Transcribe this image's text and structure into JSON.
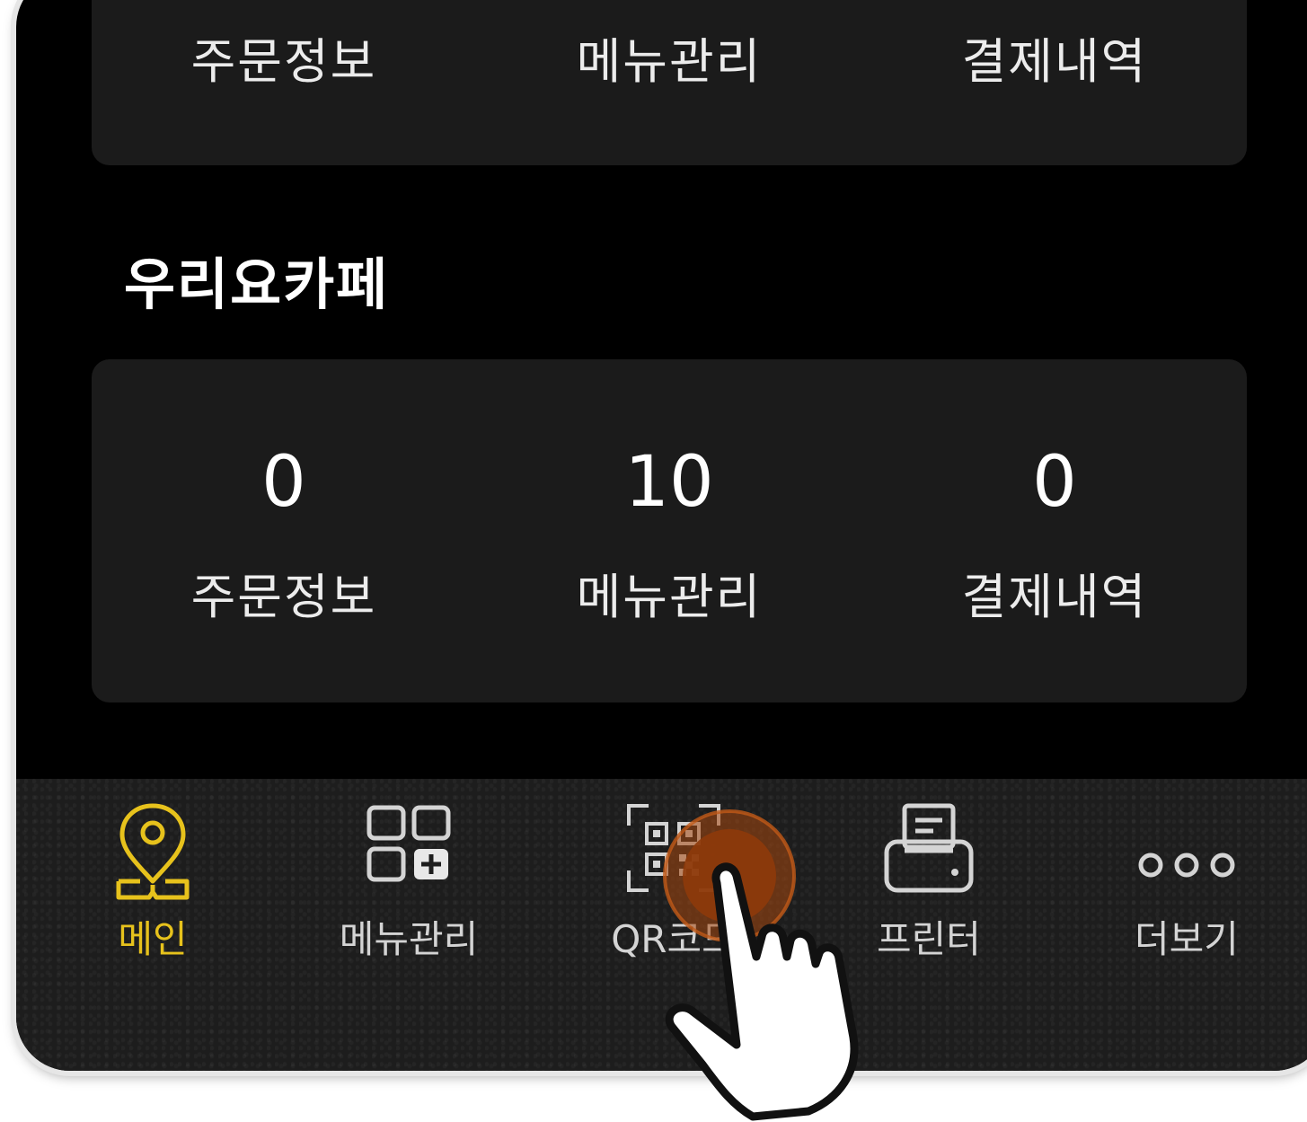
{
  "top_summary": {
    "items": [
      {
        "label": "주문정보"
      },
      {
        "label": "메뉴관리"
      },
      {
        "label": "결제내역"
      }
    ]
  },
  "store": {
    "name": "우리요카페",
    "stats": [
      {
        "value": "0",
        "label": "주문정보"
      },
      {
        "value": "10",
        "label": "메뉴관리"
      },
      {
        "value": "0",
        "label": "결제내역"
      }
    ]
  },
  "tabbar": {
    "active": "메인",
    "tabs": [
      {
        "label": "메인",
        "icon": "map-pin-book-icon"
      },
      {
        "label": "메뉴관리",
        "icon": "grid-add-icon"
      },
      {
        "label": "QR코드",
        "icon": "qr-code-icon"
      },
      {
        "label": "프린터",
        "icon": "printer-icon"
      },
      {
        "label": "더보기",
        "icon": "more-dots-icon"
      }
    ]
  },
  "colors": {
    "background": "#000000",
    "card": "#1b1b1b",
    "tabbar": "#1d1d1d",
    "active_tab": "#e7c21c",
    "inactive_tab": "#d4d4d4",
    "tap_indicator": "#a5470f"
  }
}
